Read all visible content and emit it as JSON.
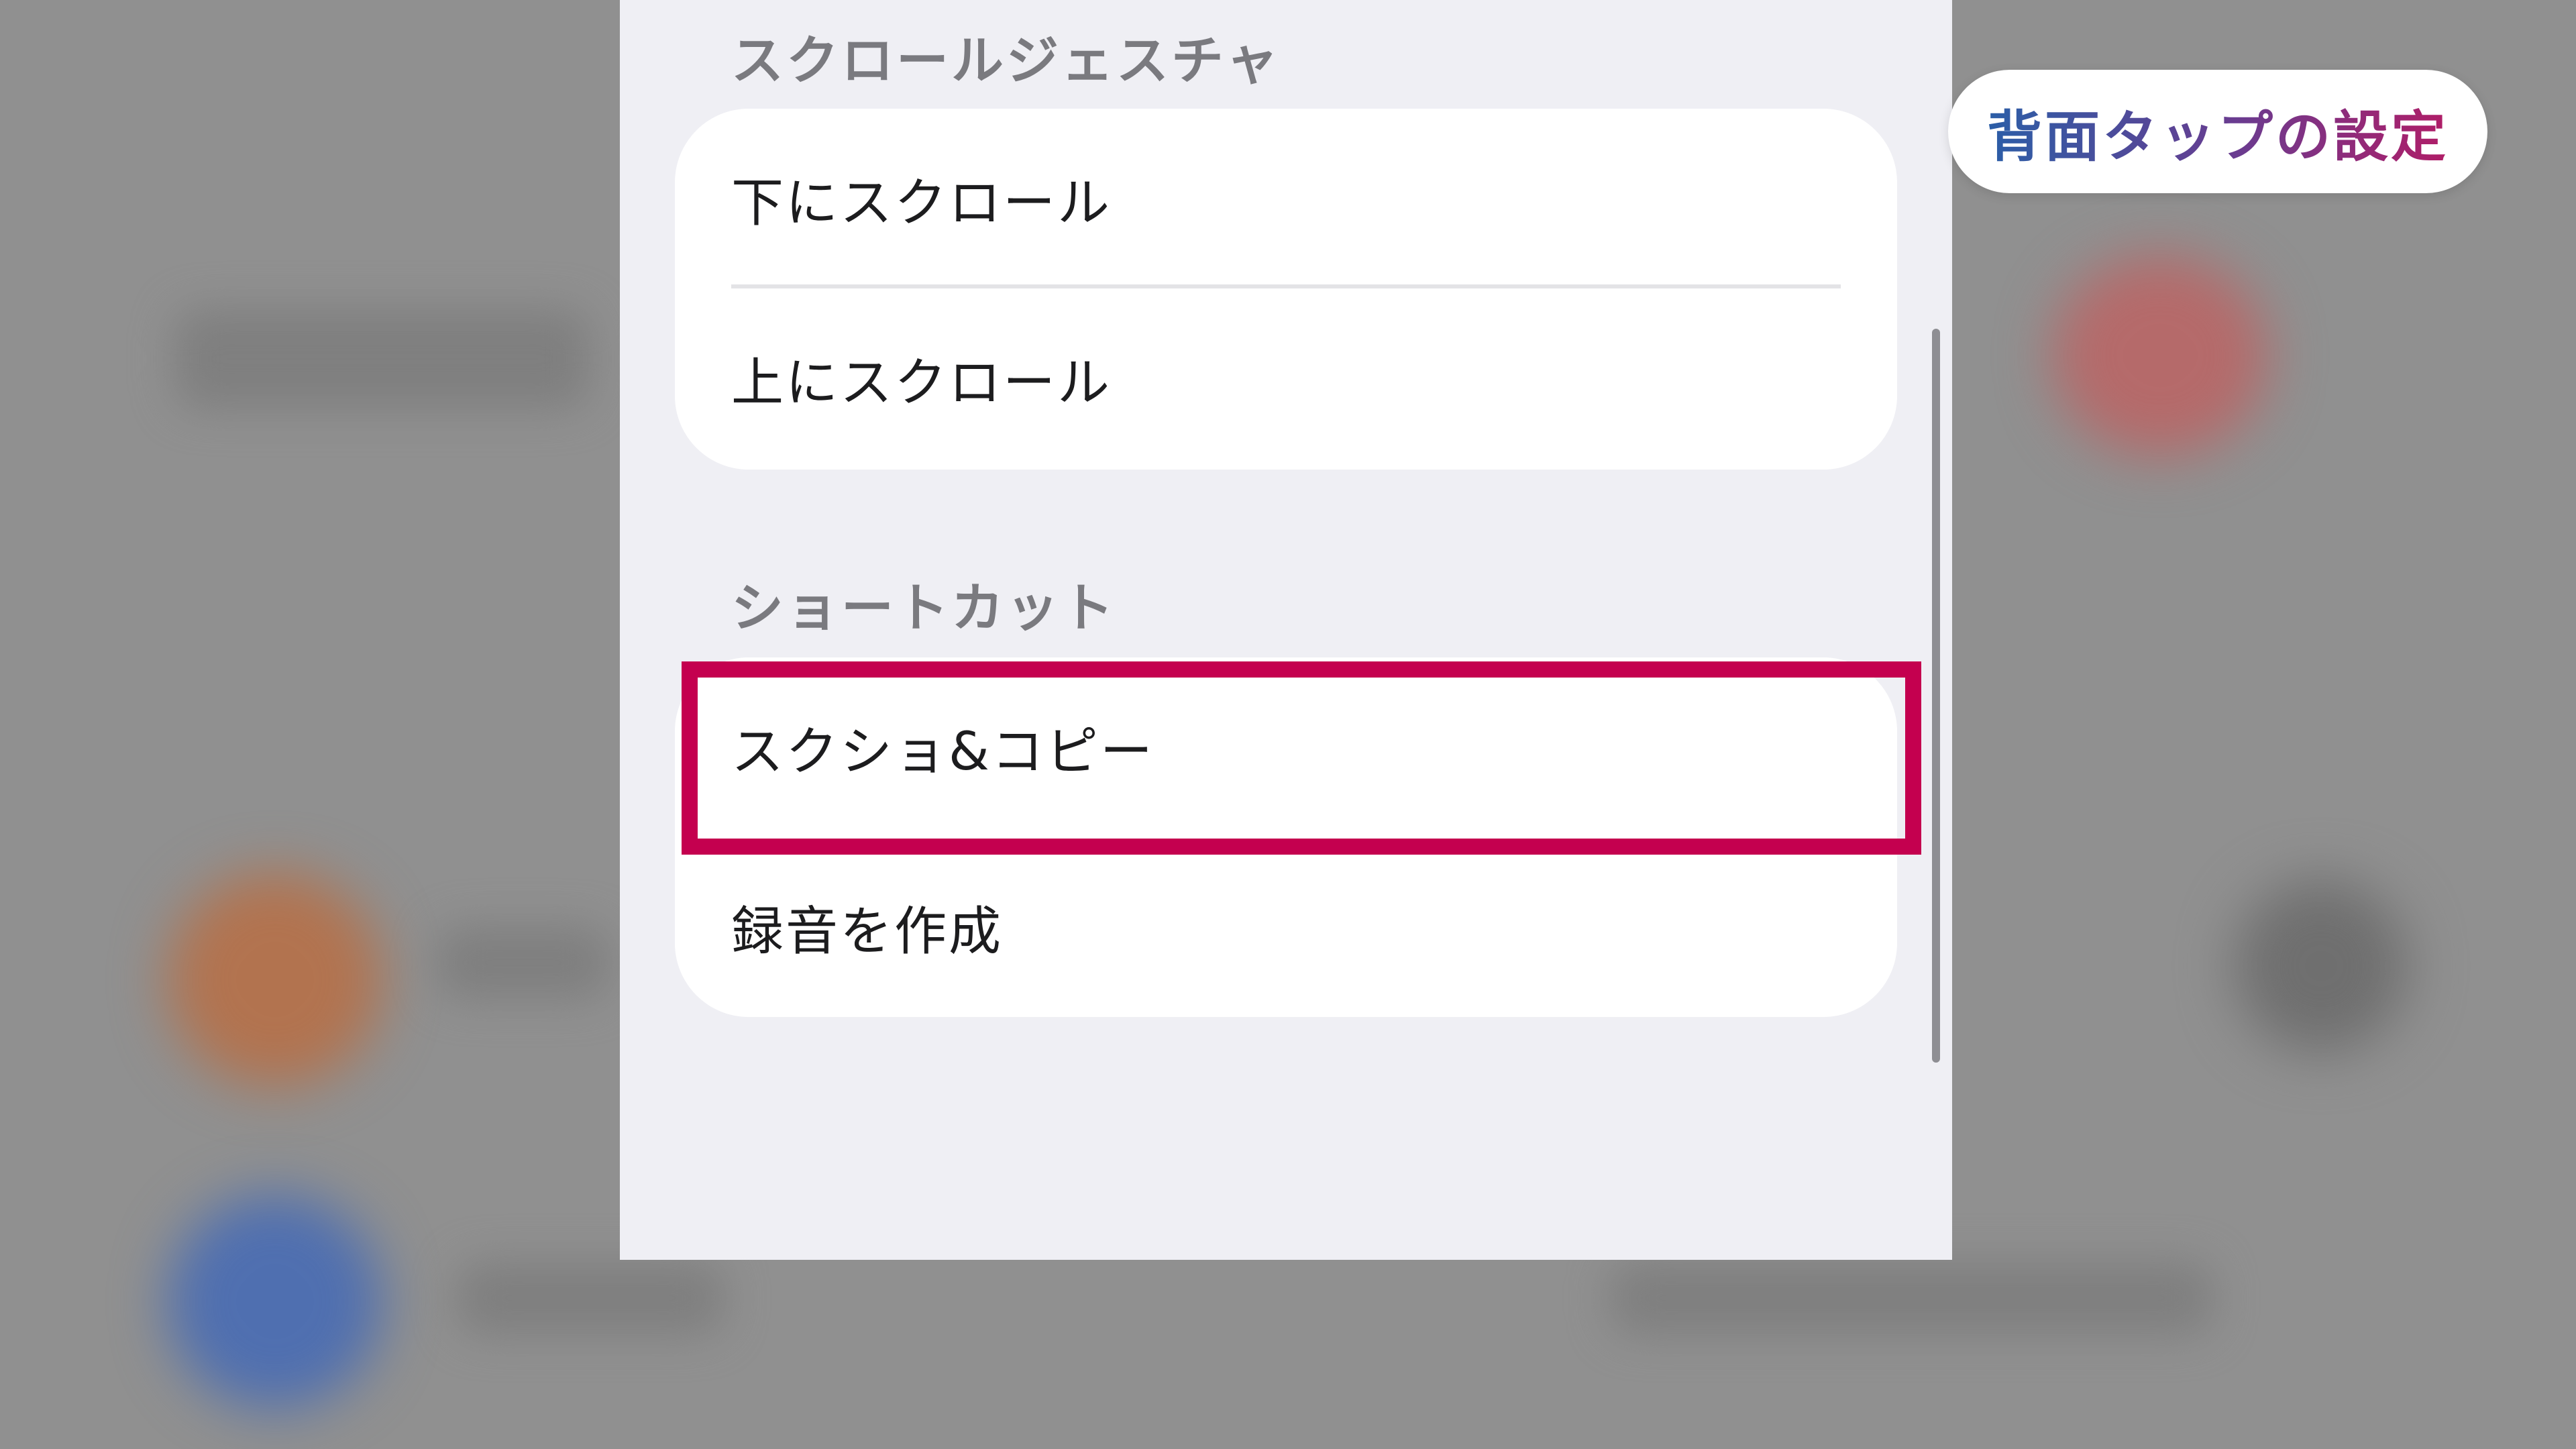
{
  "title_badge": {
    "text": "背面タップの設定"
  },
  "settings": {
    "scroll_section": {
      "header": "スクロールジェスチャ",
      "items": [
        {
          "label": "下にスクロール"
        },
        {
          "label": "上にスクロール"
        }
      ]
    },
    "shortcut_section": {
      "header": "ショートカット",
      "items": [
        {
          "label": "スクショ&コピー",
          "highlighted": true
        },
        {
          "label": "録音を作成"
        }
      ]
    }
  },
  "colors": {
    "highlight": "#c4004f",
    "sheet_background": "#efeff4",
    "group_background": "#ffffff",
    "backdrop": "#909090"
  }
}
